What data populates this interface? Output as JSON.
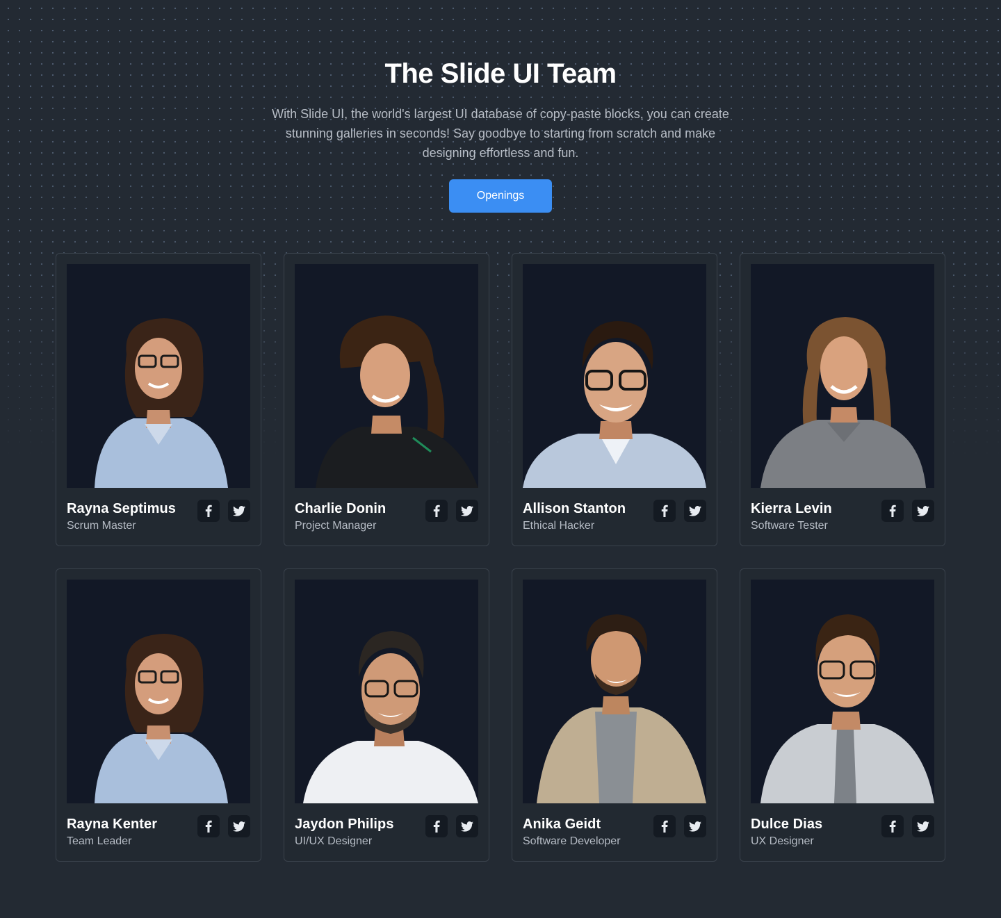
{
  "hero": {
    "title": "The Slide UI Team",
    "description": "With Slide UI, the world's largest UI database of copy-paste blocks, you can create stunning galleries in seconds! Say goodbye to starting from scratch and make designing effortless and fun.",
    "button_label": "Openings"
  },
  "colors": {
    "background": "#232a33",
    "card_border": "#3a424c",
    "photo_background": "#121826",
    "accent": "#3b8ef3"
  },
  "team": [
    {
      "name": "Rayna Septimus",
      "role": "Scrum Master"
    },
    {
      "name": "Charlie Donin",
      "role": "Project Manager"
    },
    {
      "name": "Allison Stanton",
      "role": "Ethical Hacker"
    },
    {
      "name": "Kierra Levin",
      "role": "Software Tester"
    },
    {
      "name": "Rayna Kenter",
      "role": "Team Leader"
    },
    {
      "name": "Jaydon Philips",
      "role": "UI/UX Designer"
    },
    {
      "name": "Anika Geidt",
      "role": "Software Developer"
    },
    {
      "name": "Dulce Dias",
      "role": "UX Designer"
    }
  ],
  "social_icons": [
    "facebook-icon",
    "twitter-icon"
  ]
}
